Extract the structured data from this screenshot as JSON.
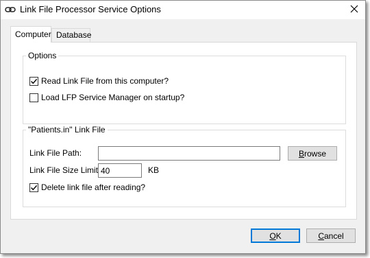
{
  "window": {
    "title": "Link File Processor Service Options",
    "icon": "chain-link-icon"
  },
  "tabs": [
    {
      "label": "Computer",
      "active": true
    },
    {
      "label": "Database",
      "active": false
    }
  ],
  "options_group": {
    "legend": "Options",
    "read_link_file": {
      "label": "Read Link File from this computer?",
      "checked": true
    },
    "load_manager": {
      "label": "Load LFP Service Manager on startup?",
      "checked": false
    }
  },
  "link_file_group": {
    "legend": "\"Patients.in\" Link File",
    "path_label": "Link File Path:",
    "path_value": "",
    "browse_button": {
      "prefix": "",
      "mnemonic": "B",
      "rest": "rowse"
    },
    "size_label": "Link File Size Limit:",
    "size_value": "40",
    "size_unit": "KB",
    "delete_after": {
      "label": "Delete link file after reading?",
      "checked": true
    }
  },
  "footer": {
    "ok": {
      "mnemonic": "O",
      "rest": "K"
    },
    "cancel": {
      "mnemonic": "C",
      "rest": "ancel"
    }
  },
  "colors": {
    "accent": "#0078d7",
    "dialog_bg": "#f0f0f0",
    "panel_bg": "#ffffff"
  }
}
